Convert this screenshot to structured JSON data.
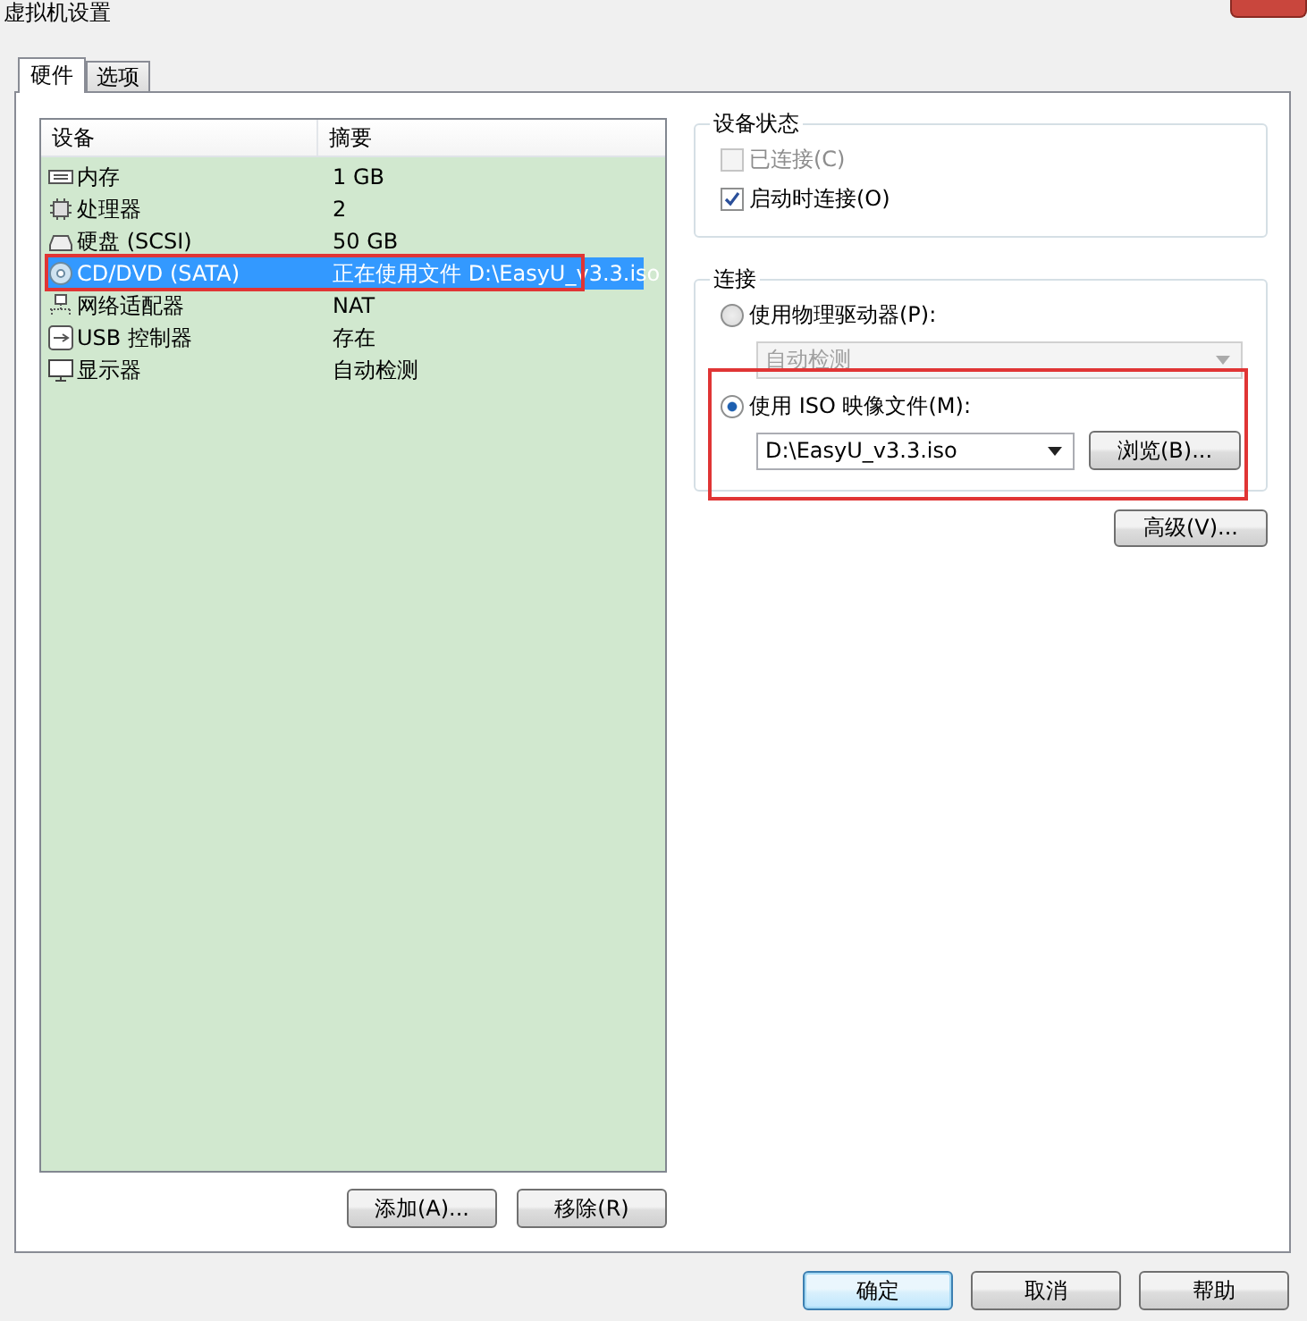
{
  "window": {
    "title": "虚拟机设置"
  },
  "tabs": [
    {
      "label": "硬件",
      "selected": true
    },
    {
      "label": "选项",
      "selected": false
    }
  ],
  "device_list": {
    "columns": [
      "设备",
      "摘要"
    ],
    "rows": [
      {
        "kind": "memory",
        "device": "内存",
        "summary": "1 GB",
        "selected": false
      },
      {
        "kind": "cpu",
        "device": "处理器",
        "summary": "2",
        "selected": false
      },
      {
        "kind": "disk",
        "device": "硬盘 (SCSI)",
        "summary": "50 GB",
        "selected": false
      },
      {
        "kind": "cd",
        "device": "CD/DVD (SATA)",
        "summary": "正在使用文件 D:\\EasyU_v3.3.iso",
        "selected": true
      },
      {
        "kind": "network",
        "device": "网络适配器",
        "summary": "NAT",
        "selected": false
      },
      {
        "kind": "usb",
        "device": "USB 控制器",
        "summary": "存在",
        "selected": false
      },
      {
        "kind": "display",
        "device": "显示器",
        "summary": "自动检测",
        "selected": false
      }
    ]
  },
  "list_buttons": [
    "添加(A)...",
    "移除(R)"
  ],
  "device_status": {
    "title": "设备状态",
    "options": [
      {
        "label": "已连接(C)",
        "checked": false,
        "disabled": true
      },
      {
        "label": "启动时连接(O)",
        "checked": true,
        "disabled": false
      }
    ]
  },
  "connection": {
    "title": "连接",
    "physical_option": {
      "label": "使用物理驱动器(P):",
      "selected": false
    },
    "physical_drive": {
      "value": "自动检测",
      "disabled": true
    },
    "iso_option": {
      "label": "使用 ISO 映像文件(M):",
      "selected": true
    },
    "iso_file": {
      "value": "D:\\EasyU_v3.3.iso"
    },
    "browse_button": "浏览(B)...",
    "advanced_button": "高级(V)..."
  },
  "dialog_buttons": [
    {
      "label": "确定",
      "default": true
    },
    {
      "label": "取消",
      "default": false
    },
    {
      "label": "帮助",
      "default": false
    }
  ]
}
